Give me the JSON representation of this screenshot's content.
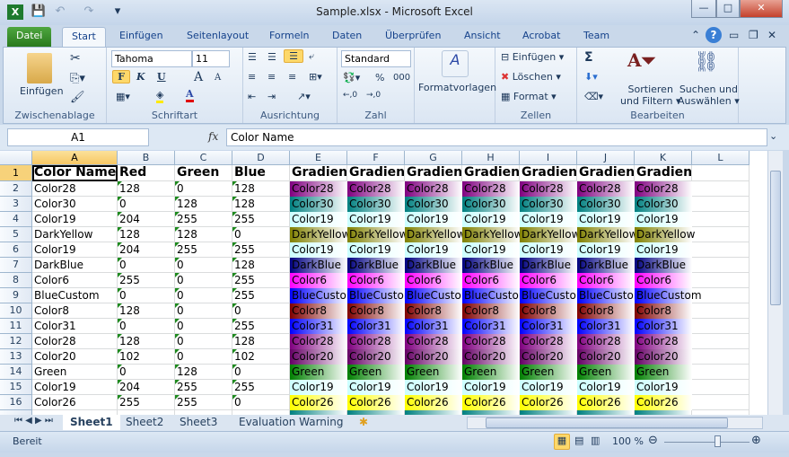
{
  "window": {
    "title": "Sample.xlsx - Microsoft Excel",
    "minimize": "—",
    "maximize": "□",
    "close": "✕"
  },
  "qat": {
    "app_icon": "X",
    "save": "💾",
    "undo": "↶",
    "redo": "↷",
    "customize": "▾"
  },
  "tabs": [
    {
      "label": "Datei"
    },
    {
      "label": "Start"
    },
    {
      "label": "Einfügen"
    },
    {
      "label": "Seitenlayout"
    },
    {
      "label": "Formeln"
    },
    {
      "label": "Daten"
    },
    {
      "label": "Überprüfen"
    },
    {
      "label": "Ansicht"
    },
    {
      "label": "Acrobat"
    },
    {
      "label": "Team"
    }
  ],
  "ribbon": {
    "clipboard": {
      "label": "Zwischenablage",
      "paste": "Einfügen"
    },
    "font": {
      "label": "Schriftart",
      "font_name": "Tahoma",
      "font_size": "11",
      "bold": "F",
      "italic": "K",
      "underline": "U",
      "grow": "A",
      "shrink": "A",
      "font_color": "A"
    },
    "alignment": {
      "label": "Ausrichtung"
    },
    "number": {
      "label": "Zahl",
      "format": "Standard",
      "percent": "%",
      "thousands": "000"
    },
    "styles": {
      "label": "Formatvorlagen"
    },
    "cells": {
      "label": "Zellen",
      "insert": "Einfügen",
      "delete": "Löschen",
      "format": "Format"
    },
    "editing": {
      "label": "Bearbeiten",
      "sum": "Σ",
      "sort_filter_1": "Sortieren",
      "sort_filter_2": "und Filtern",
      "find_1": "Suchen und",
      "find_2": "Auswählen"
    }
  },
  "formula_bar": {
    "name_box": "A1",
    "fx": "fx",
    "value": "Color Name"
  },
  "grid": {
    "columns": [
      "A",
      "B",
      "C",
      "D",
      "E",
      "F",
      "G",
      "H",
      "I",
      "J",
      "K",
      "L"
    ],
    "selected_cell": "A1",
    "header_row": [
      "Color Name",
      "Red",
      "Green",
      "Blue",
      "Gradient",
      "Gradient",
      "Gradient",
      "Gradient",
      "Gradient",
      "Gradient",
      "Gradient"
    ],
    "rows": [
      {
        "num": "2",
        "name": "Color28",
        "r": "128",
        "g": "0",
        "b": "128"
      },
      {
        "num": "3",
        "name": "Color30",
        "r": "0",
        "g": "128",
        "b": "128"
      },
      {
        "num": "4",
        "name": "Color19",
        "r": "204",
        "g": "255",
        "b": "255"
      },
      {
        "num": "5",
        "name": "DarkYellow",
        "r": "128",
        "g": "128",
        "b": "0"
      },
      {
        "num": "6",
        "name": "Color19",
        "r": "204",
        "g": "255",
        "b": "255"
      },
      {
        "num": "7",
        "name": "DarkBlue",
        "r": "0",
        "g": "0",
        "b": "128"
      },
      {
        "num": "8",
        "name": "Color6",
        "r": "255",
        "g": "0",
        "b": "255"
      },
      {
        "num": "9",
        "name": "BlueCustom",
        "r": "0",
        "g": "0",
        "b": "255"
      },
      {
        "num": "10",
        "name": "Color8",
        "r": "128",
        "g": "0",
        "b": "0"
      },
      {
        "num": "11",
        "name": "Color31",
        "r": "0",
        "g": "0",
        "b": "255"
      },
      {
        "num": "12",
        "name": "Color28",
        "r": "128",
        "g": "0",
        "b": "128"
      },
      {
        "num": "13",
        "name": "Color20",
        "r": "102",
        "g": "0",
        "b": "102"
      },
      {
        "num": "14",
        "name": "Green",
        "r": "0",
        "g": "128",
        "b": "0"
      },
      {
        "num": "15",
        "name": "Color19",
        "r": "204",
        "g": "255",
        "b": "255"
      },
      {
        "num": "16",
        "name": "Color26",
        "r": "255",
        "g": "255",
        "b": "0"
      }
    ]
  },
  "sheets": {
    "tabs": [
      {
        "label": "Sheet1",
        "active": true
      },
      {
        "label": "Sheet2"
      },
      {
        "label": "Sheet3"
      },
      {
        "label": "Evaluation Warning"
      }
    ]
  },
  "status": {
    "ready": "Bereit",
    "zoom": "100 %",
    "zoom_percent": 100
  }
}
